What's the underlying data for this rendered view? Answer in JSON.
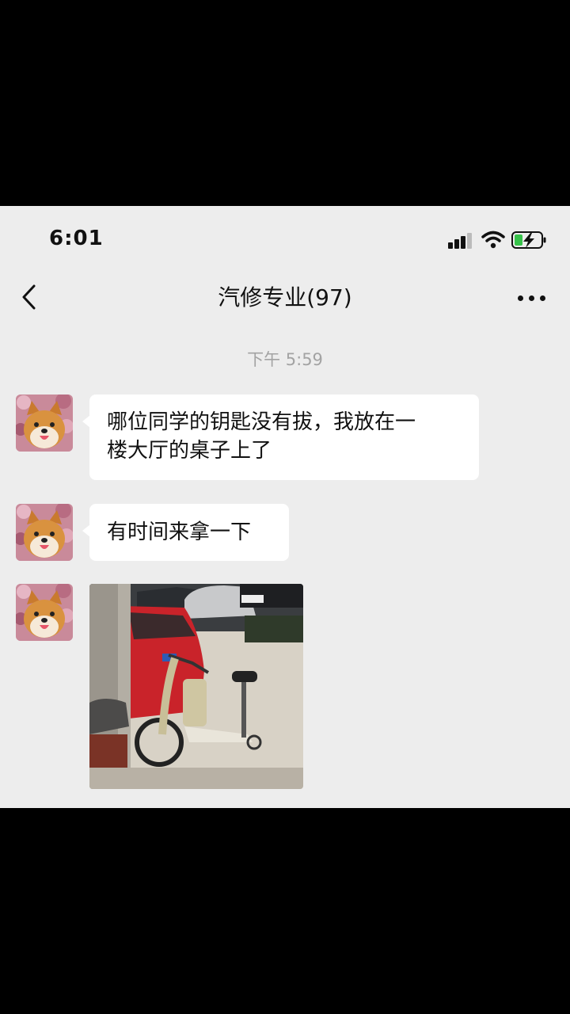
{
  "status_bar": {
    "time": "6:01",
    "icons": [
      "signal-icon",
      "wifi-icon",
      "battery-charging-icon"
    ]
  },
  "nav": {
    "back_icon": "chevron-left-icon",
    "title": "汽修专业(97)",
    "more_icon": "more-dots-icon"
  },
  "chat": {
    "timestamp": "下午 5:59",
    "messages": [
      {
        "type": "text",
        "avatar": "shiba-dog-avatar",
        "text_line1": "哪位同学的钥匙没有拔，我放在一",
        "text_line2": "楼大厅的桌子上了"
      },
      {
        "type": "text",
        "avatar": "shiba-dog-avatar",
        "text": "有时间来拿一下"
      },
      {
        "type": "image",
        "avatar": "shiba-dog-avatar",
        "image": "photo-electric-scooter-parked-by-red-car"
      }
    ]
  },
  "colors": {
    "chat_background": "#ededed",
    "bubble": "#ffffff",
    "timestamp_text": "#a3a3a3",
    "outer_background": "#000000"
  }
}
